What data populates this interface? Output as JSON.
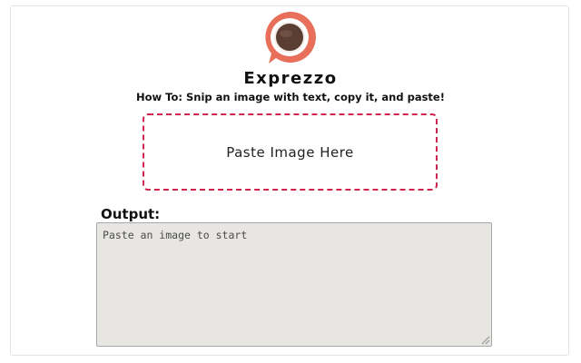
{
  "app": {
    "title": "Exprezzo",
    "howto": "How To: Snip an image with text, copy it, and paste!"
  },
  "dropzone": {
    "label": "Paste Image Here"
  },
  "output": {
    "label": "Output:",
    "value": "",
    "placeholder": "Paste an image to start"
  },
  "colors": {
    "logo_ring": "#e86f59",
    "cup": "#5a3d33",
    "dropzone_border": "#d1234f",
    "output_bg": "#e8e6e3"
  },
  "icons": {
    "logo": "coffee-cup-speech-bubble-logo",
    "resize": "resize-grip-icon"
  }
}
